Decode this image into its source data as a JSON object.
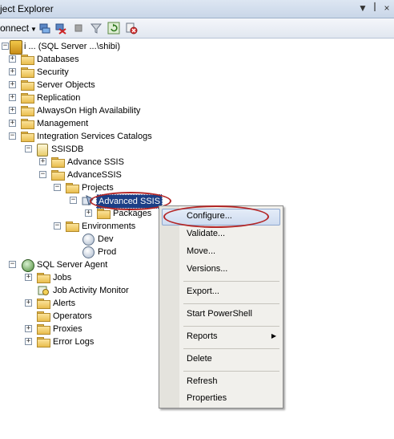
{
  "window": {
    "title": "ject Explorer",
    "pin_glyph": "▼",
    "pin2_glyph": "ꟾ",
    "close_glyph": "×"
  },
  "toolbar": {
    "connect_label": "onnect",
    "connect_arrow": "▼",
    "icons": [
      "connect-object-icon",
      "disconnect-icon",
      "stop-icon",
      "filter-icon",
      "refresh-icon",
      "remove-filter-icon"
    ]
  },
  "tree": {
    "server_label": "i ... (SQL Server ...\\shibi)",
    "nodes": {
      "databases": "Databases",
      "security": "Security",
      "server_objects": "Server Objects",
      "replication": "Replication",
      "alwayson": "AlwaysOn High Availability",
      "management": "Management",
      "isc": "Integration Services Catalogs",
      "ssisdb": "SSISDB",
      "advance_ssis": "Advance SSIS",
      "advancessis": "AdvanceSSIS",
      "projects": "Projects",
      "advanced_ssis": "Advanced SSIS",
      "packages": "Packages",
      "environments": "Environments",
      "dev": "Dev",
      "prod": "Prod",
      "sql_agent": "SQL Server Agent",
      "jobs": "Jobs",
      "job_activity": "Job Activity Monitor",
      "alerts": "Alerts",
      "operators": "Operators",
      "proxies": "Proxies",
      "error_logs": "Error Logs"
    },
    "expanded_glyph": "−",
    "collapsed_glyph": "+"
  },
  "context_menu": {
    "items": [
      {
        "label": "Configure..."
      },
      {
        "label": "Validate..."
      },
      {
        "label": "Move..."
      },
      {
        "label": "Versions..."
      },
      {
        "label": "Export..."
      },
      {
        "label": "Start PowerShell"
      },
      {
        "label": "Reports"
      },
      {
        "label": "Delete"
      },
      {
        "label": "Refresh"
      },
      {
        "label": "Properties"
      }
    ],
    "submenu_arrow": "▶",
    "highlight_color": "#cfdcf0",
    "annotation_color": "#b32626"
  }
}
